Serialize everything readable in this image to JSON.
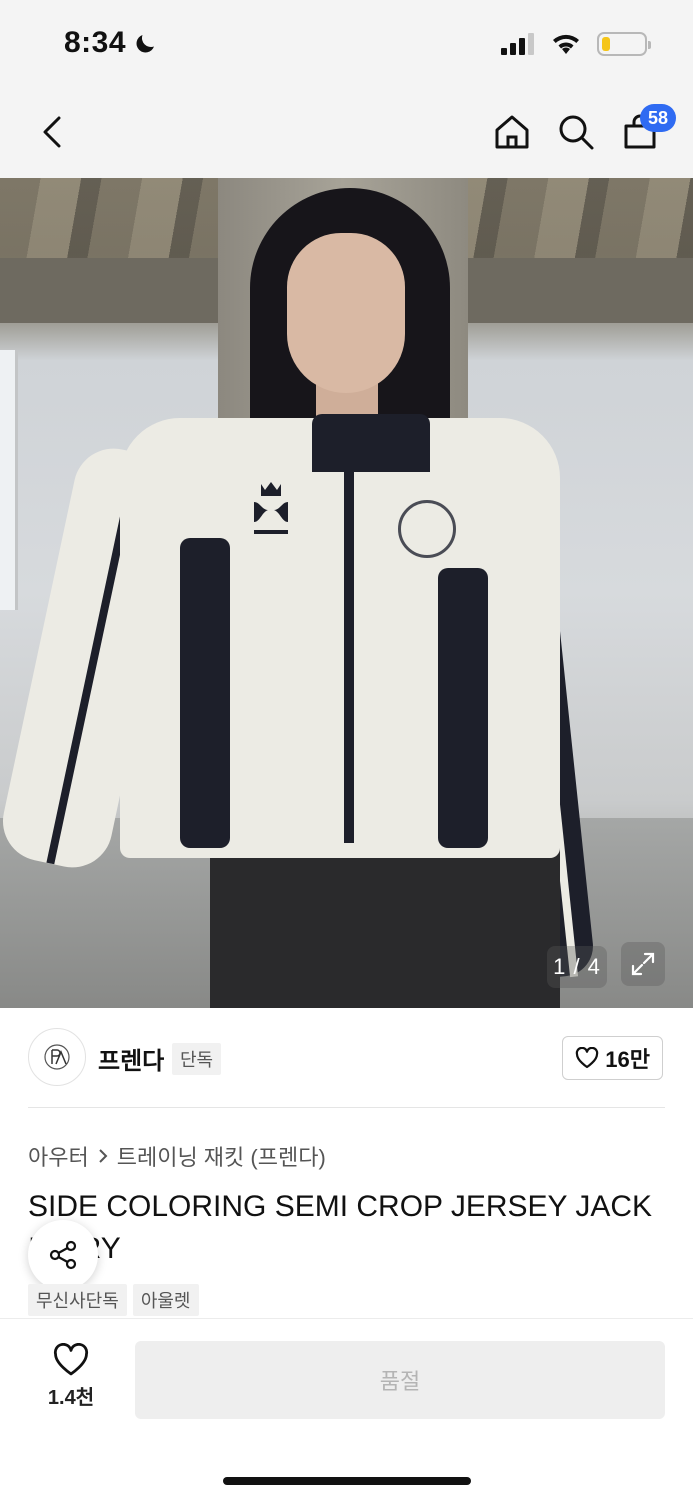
{
  "status_bar": {
    "time": "8:34",
    "battery_level": 0.2,
    "battery_color": "#f5c518"
  },
  "nav": {
    "back_icon": "chevron-left-icon",
    "home_icon": "home-icon",
    "search_icon": "search-icon",
    "cart_icon": "shopping-bag-icon",
    "cart_count": "58",
    "badge_color": "#2f6bf2"
  },
  "hero": {
    "counter": "1 / 4",
    "expand_icon": "expand-icon"
  },
  "brand": {
    "name": "프렌다",
    "tag": "단독",
    "likes": "16만"
  },
  "product": {
    "breadcrumb": [
      "아우터",
      "트레이닝 재킷 (프렌다)"
    ],
    "title": "SIDE COLORING SEMI CROP JERSEY JACK\nIVORY",
    "title_line1": "SIDE COLORING SEMI CROP JERSEY JACK",
    "title_line2": "IVORY",
    "tags": [
      "무신사단독",
      "아울렛"
    ]
  },
  "bottom": {
    "wish_count": "1.4천",
    "buy_label": "품절"
  }
}
